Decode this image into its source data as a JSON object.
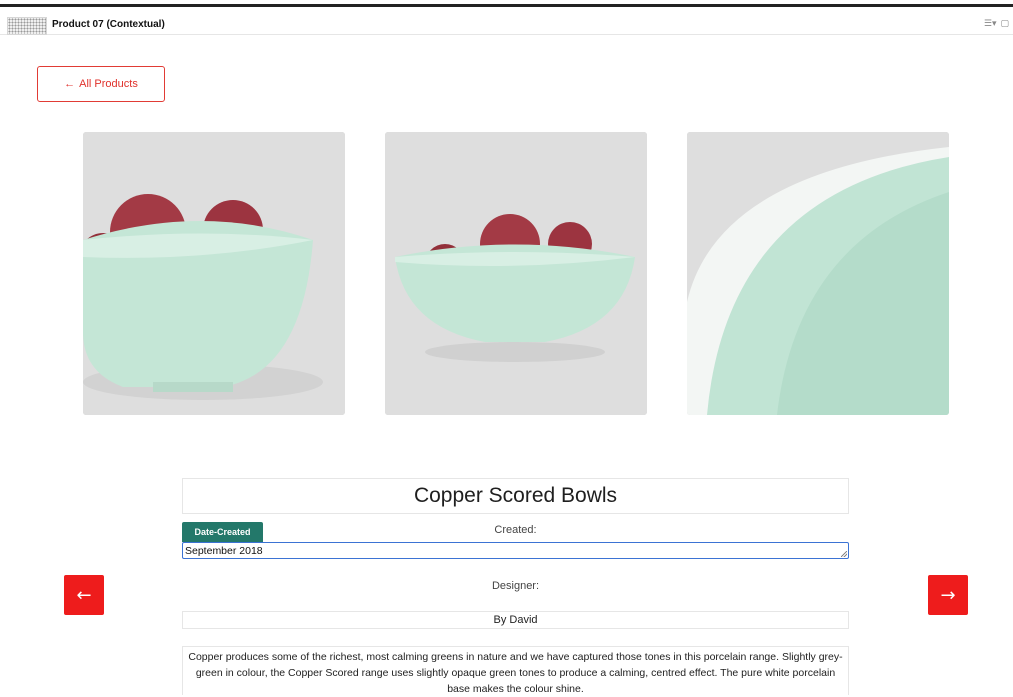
{
  "window": {
    "title": "Product 07 (Contextual)",
    "icons": [
      "list-icon",
      "window-icon"
    ]
  },
  "nav": {
    "back_arrow": "←",
    "back_label": "All Products"
  },
  "gallery": {
    "images": [
      "bowl-with-apples-side",
      "bowl-with-apples-front",
      "bowl-interior-closeup"
    ]
  },
  "product": {
    "title": "Copper Scored Bowls",
    "badge": "Date-Created",
    "created_label": "Created:",
    "created_value": "September 2018",
    "designer_label": "Designer:",
    "designer_value": "By David",
    "description": "Copper produces some of the richest, most calming greens in nature and we have captured those tones in this porcelain range. Slightly grey-green in colour, the Copper Scored range uses slightly opaque green tones to produce a calming, centred effect. The pure white porcelain base makes the colour shine."
  },
  "arrows": {
    "prev": "←",
    "next": "→"
  },
  "colors": {
    "accent_red": "#ee1c1c",
    "badge_green": "#23786a",
    "input_focus": "#3b73d4",
    "glaze": "#bfe3d3"
  }
}
